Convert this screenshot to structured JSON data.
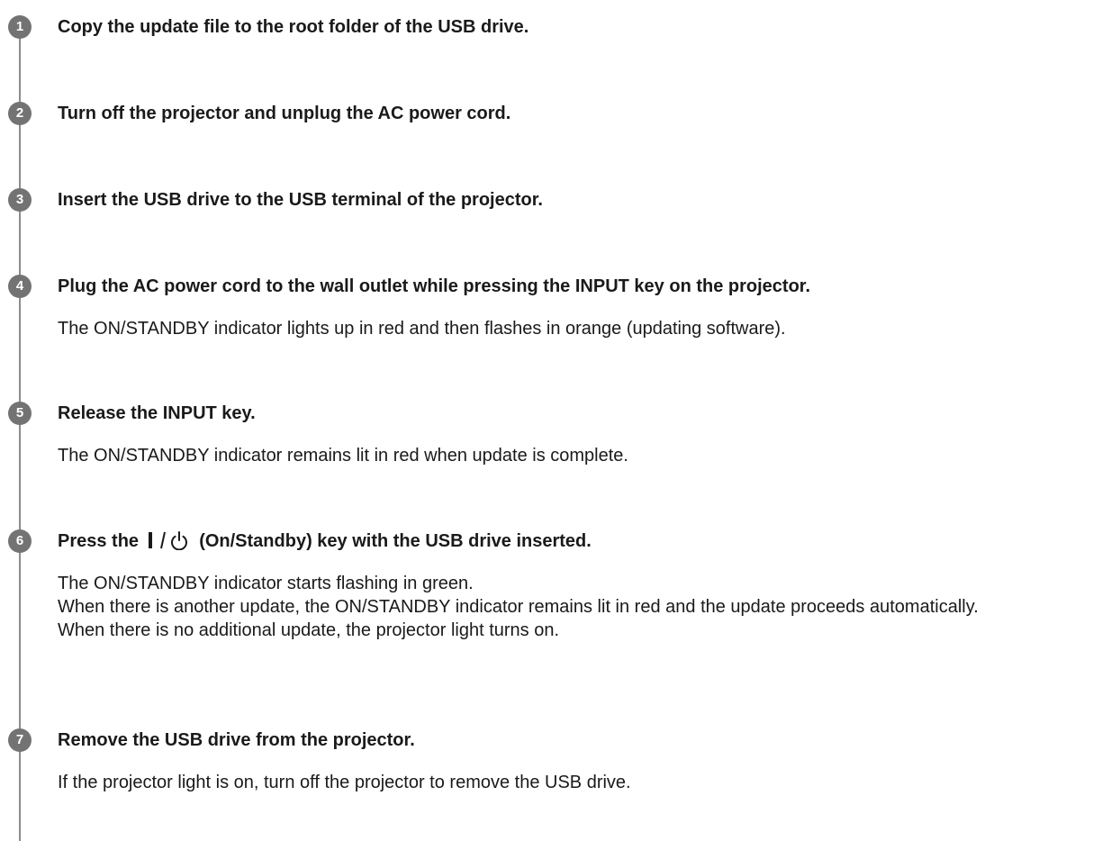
{
  "steps": [
    {
      "number": "1",
      "title": "Copy the update file to the root folder of the USB drive."
    },
    {
      "number": "2",
      "title": "Turn off the projector and unplug the AC power cord."
    },
    {
      "number": "3",
      "title": "Insert the USB drive to the USB terminal of the projector."
    },
    {
      "number": "4",
      "title": "Plug the AC power cord to the wall outlet while pressing the INPUT key on the projector.",
      "description": "The ON/STANDBY indicator lights up in red and then flashes in orange (updating software)."
    },
    {
      "number": "5",
      "title": "Release the INPUT key.",
      "description": "The ON/STANDBY indicator remains lit in red when update is complete."
    },
    {
      "number": "6",
      "title_before": "Press the",
      "title_after": "(On/Standby) key with the USB drive inserted.",
      "title_icon": "on-standby-power-icon",
      "description_lines": [
        "The ON/STANDBY indicator starts flashing in green.",
        "When there is another update, the ON/STANDBY indicator remains lit in red and the update proceeds automatically.",
        "When there is no additional update, the projector light turns on."
      ]
    },
    {
      "number": "7",
      "title": "Remove the USB drive from the projector.",
      "description": "If the projector light is on, turn off the projector to remove the USB drive."
    }
  ],
  "colors": {
    "badge": "#737373",
    "timeline": "#8c8c8c",
    "text": "#1a1a1a"
  }
}
